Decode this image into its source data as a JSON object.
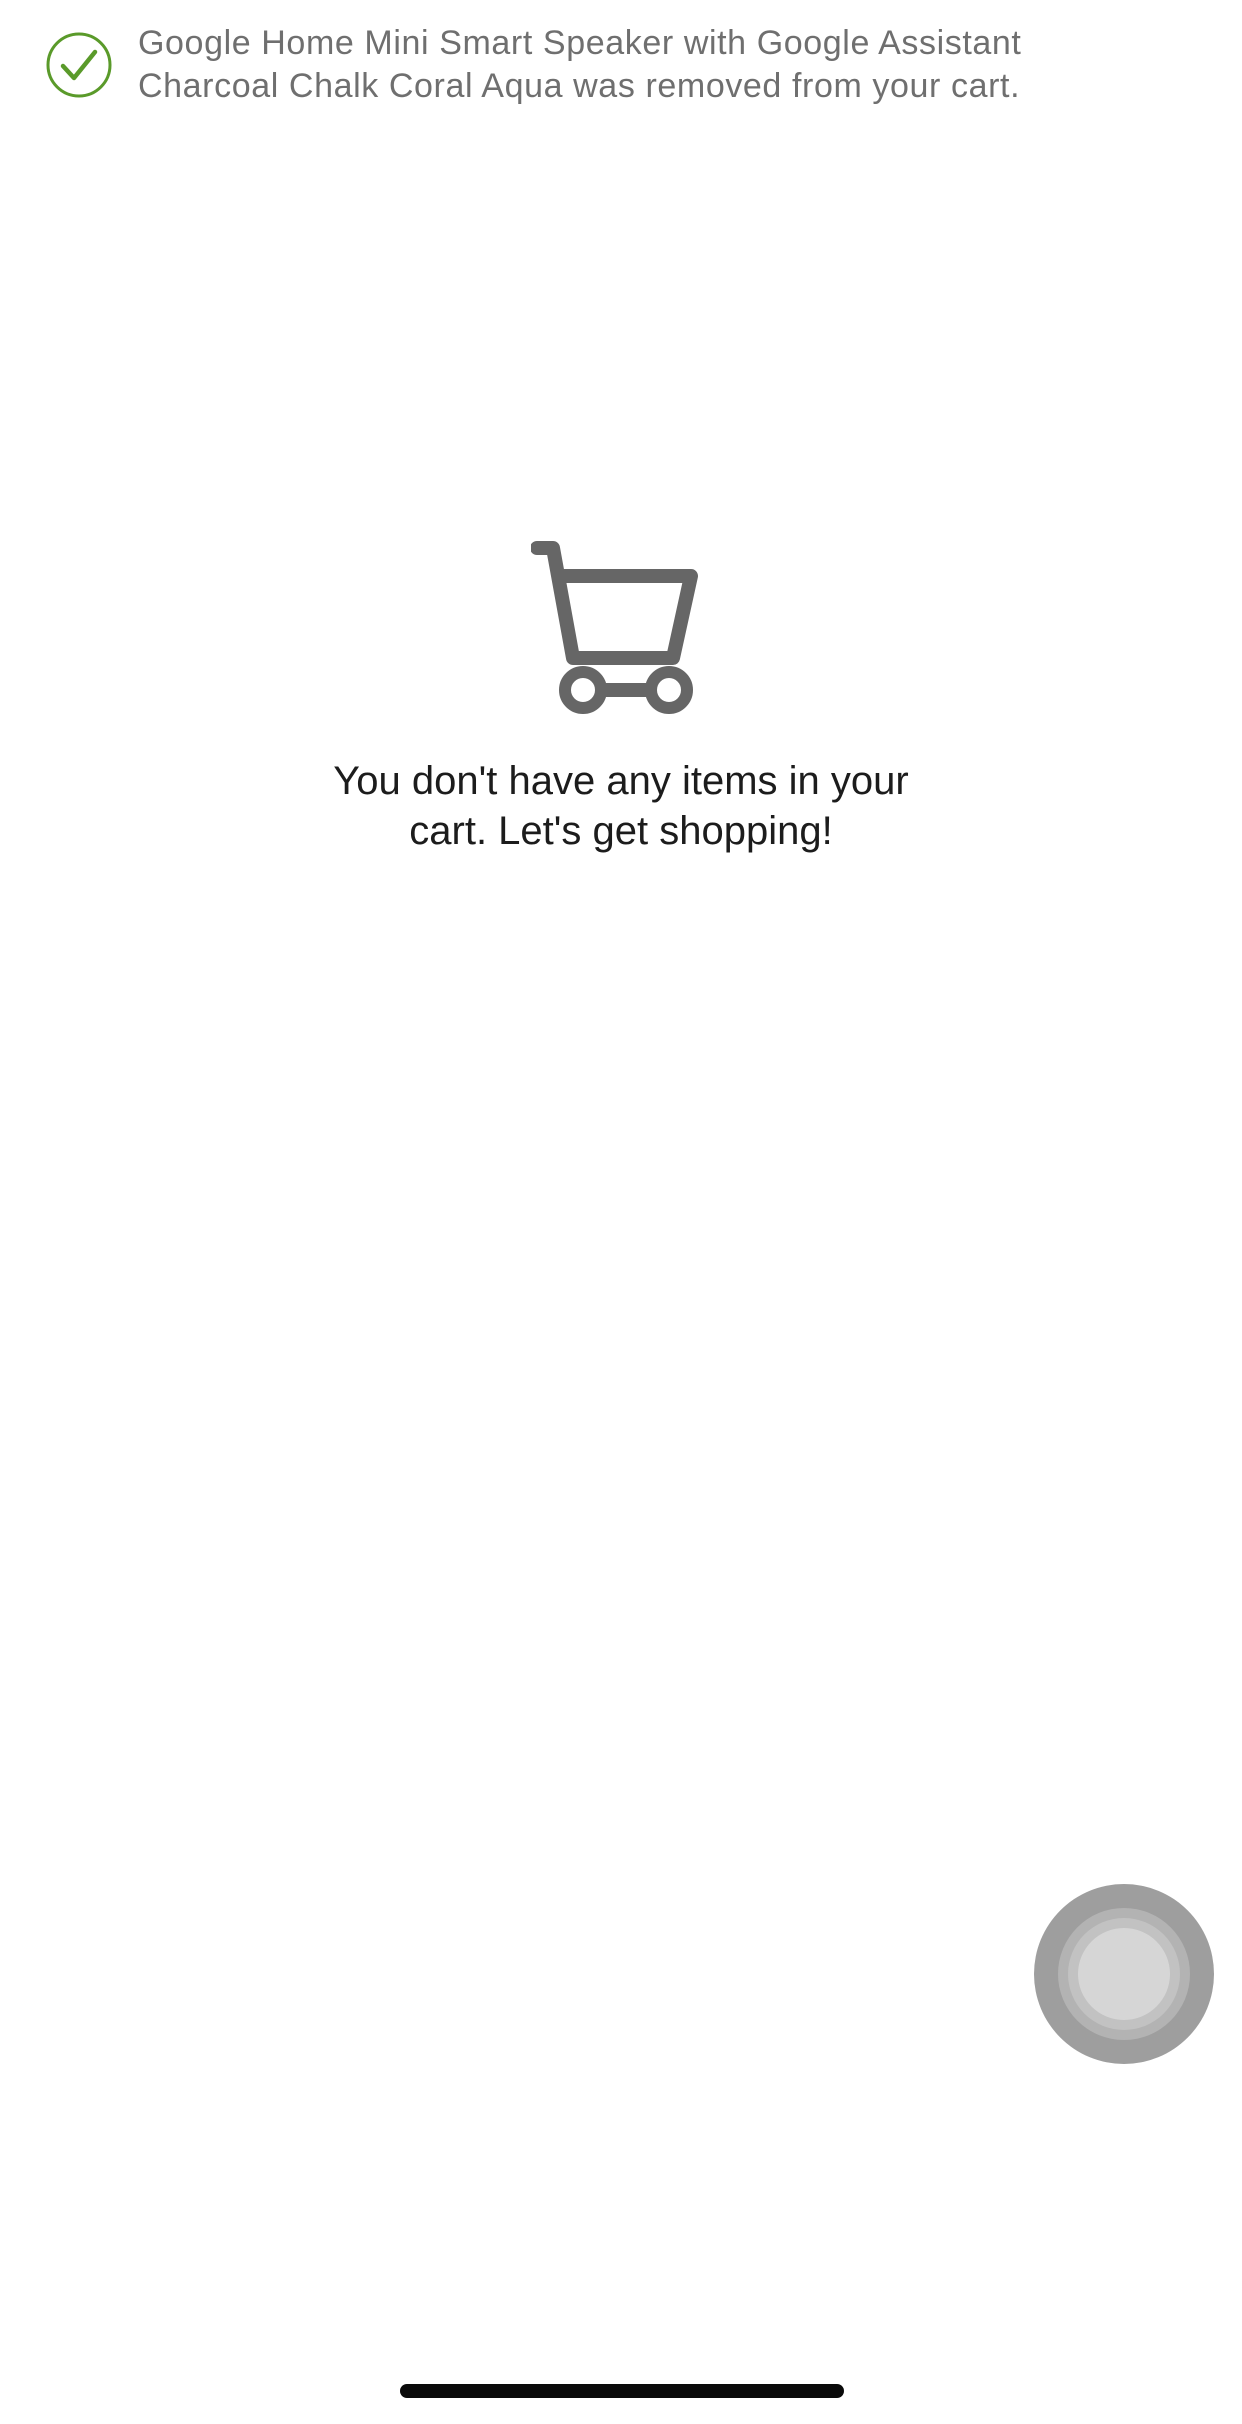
{
  "toast": {
    "message": "Google Home Mini Smart Speaker with Google Assistant\nCharcoal Chalk Coral Aqua was removed from your cart.",
    "icon": "check-circle-icon",
    "accent_color": "#5a9a2a"
  },
  "empty_cart": {
    "icon": "shopping-cart-icon",
    "icon_color": "#666666",
    "message": "You don't have any items in your\ncart. Let's get shopping!"
  },
  "assistive_touch": {
    "icon": "assistive-touch-icon"
  }
}
